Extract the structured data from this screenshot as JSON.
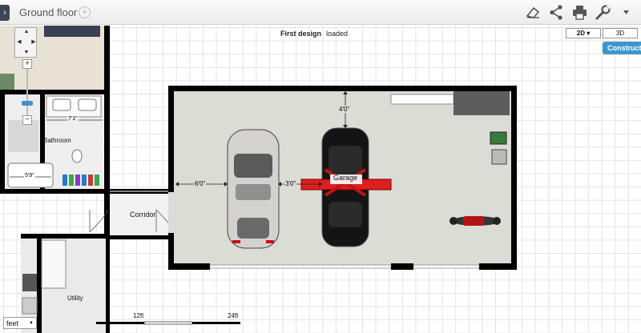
{
  "toolbar": {
    "floor_name": "Ground floor",
    "icons": [
      "eraser-icon",
      "share-icon",
      "printer-icon",
      "wrench-icon",
      "chevron-down-icon"
    ]
  },
  "status": {
    "design_name": "First design",
    "state": "loaded"
  },
  "view": {
    "mode_2d": "2D",
    "mode_3d": "3D",
    "construction_label": "Construction"
  },
  "rooms": {
    "garage": "Garage",
    "corridor": "Corridor",
    "bathroom": "Bathroom",
    "utility": "Utility"
  },
  "dimensions": {
    "garage_top_clearance": "4'0\"",
    "car_left_clearance": "6'0\"",
    "car_gap": "3'0\"",
    "bath_width": "7'1\"",
    "tub_width": "5'9\""
  },
  "scale": {
    "unit": "feet",
    "mark_1": "12ft",
    "mark_2": "24ft"
  },
  "colors": {
    "accent": "#3d97cf",
    "wall": "#000000",
    "floor": "#dcdcd6",
    "lift": "#e01e1e"
  }
}
